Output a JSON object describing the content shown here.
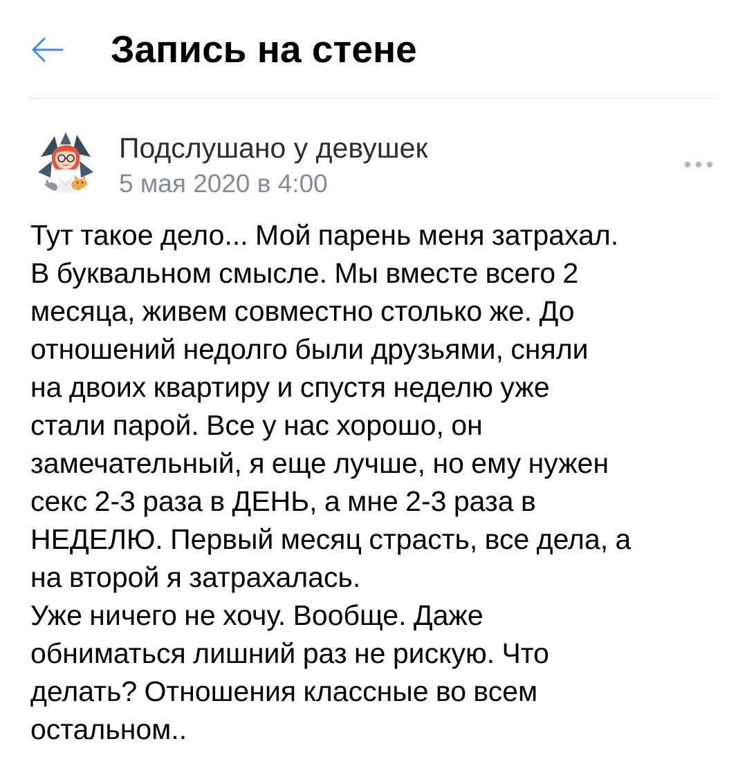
{
  "header": {
    "back_icon": "arrow-left-icon",
    "title": "Запись на стене",
    "accent_color": "#3f8ae0"
  },
  "post": {
    "author": "Подслушано у девушек",
    "date": "5 мая 2020 в 4:00",
    "more_icon": "more-horizontal-icon",
    "avatar_icon": "cartoon-girl-avatar-icon",
    "lines": [
      "Тут такое дело... Мой парень меня затрахал.",
      "В буквальном смысле. Мы вместе всего 2",
      "месяца, живем совместно столько же. До",
      "отношений недолго были друзьями, сняли",
      "на двоих квартиру и спустя неделю уже",
      "стали парой. Все у нас хорошо, он",
      "замечательный, я еще лучше, но ему нужен",
      "секс 2-3 раза в ДЕНЬ, а мне 2-3 раза в",
      "НЕДЕЛЮ. Первый месяц страсть, все дела, а",
      "на второй я затрахалась.",
      "Уже ничего не хочу. Вообще. Даже",
      "обниматься лишний раз не рискую. Что",
      "делать? Отношения классные во всем",
      "остальном.."
    ]
  },
  "colors": {
    "text_primary": "#000000",
    "text_secondary": "#818c99",
    "author_name": "#2c2d2e",
    "divider": "#e3e4e8",
    "icon_gray": "#aeb7c2"
  }
}
